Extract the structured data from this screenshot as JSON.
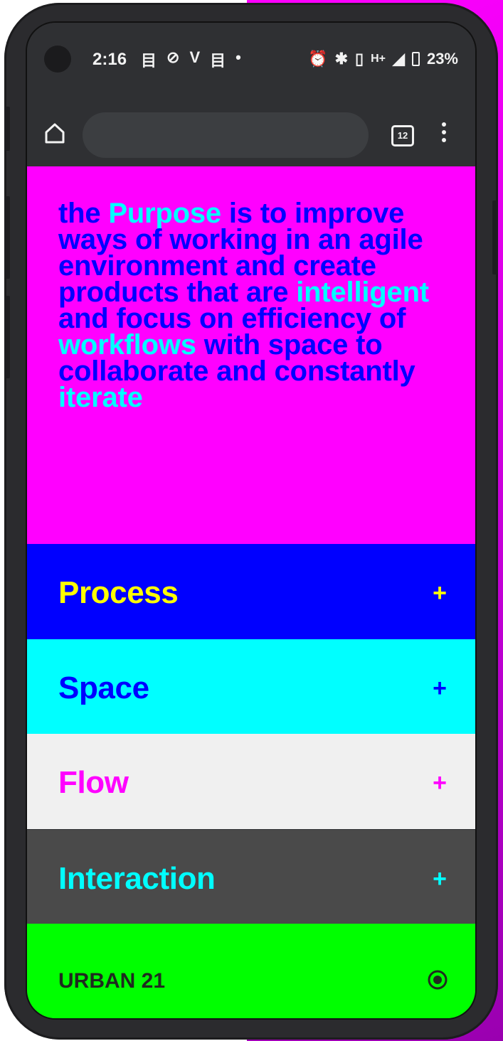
{
  "status_bar": {
    "time": "2:16",
    "left_icons": [
      "目",
      "⊘",
      "V",
      "目",
      "•"
    ],
    "right_icons": [
      "⏰",
      "✱",
      "▯",
      "H+",
      "◢"
    ],
    "battery": "23%"
  },
  "browser": {
    "tab_count": "12"
  },
  "hero": {
    "segments": [
      {
        "text": "the ",
        "highlight": false
      },
      {
        "text": "Purpose",
        "highlight": true
      },
      {
        "text": " is to improve ways of working in an agile environment and create products that are ",
        "highlight": false
      },
      {
        "text": "intelligent",
        "highlight": true
      },
      {
        "text": " and focus on efficiency of ",
        "highlight": false
      },
      {
        "text": "workflows",
        "highlight": true
      },
      {
        "text": " with space to collaborate and constantly ",
        "highlight": false
      },
      {
        "text": "iterate",
        "highlight": true
      }
    ]
  },
  "sections": [
    {
      "label": "Process",
      "icon": "+",
      "background": "#0000ff",
      "color": "#ffff00"
    },
    {
      "label": "Space",
      "icon": "+",
      "background": "#00ffff",
      "color": "#0000ff"
    },
    {
      "label": "Flow",
      "icon": "+",
      "background": "#f0f0f0",
      "color": "#ff00ff"
    },
    {
      "label": "Interaction",
      "icon": "+",
      "background": "#4a4a4a",
      "color": "#00ffff"
    }
  ],
  "footer": {
    "label": "URBAN 21",
    "icon": "radio-target-icon"
  },
  "colors": {
    "hero_bg": "#ff00ff",
    "hero_text": "#0000ff",
    "hero_highlight": "#00ffff",
    "footer_bg": "#00ff00"
  }
}
